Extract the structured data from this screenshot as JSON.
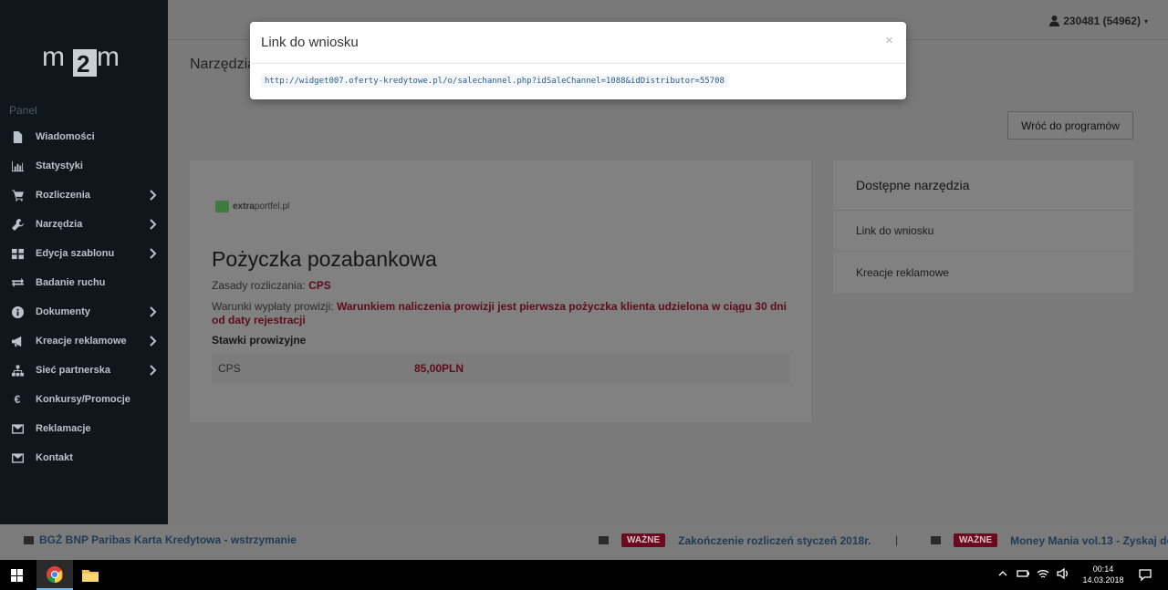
{
  "sidebar": {
    "logo_text": "m2m",
    "panel_label": "Panel",
    "items": [
      {
        "label": "Wiadomości",
        "icon": "document-icon"
      },
      {
        "label": "Statystyki",
        "icon": "bar-chart-icon"
      },
      {
        "label": "Rozliczenia",
        "icon": "cart-icon"
      },
      {
        "label": "Narzędzia",
        "icon": "wrench-icon"
      },
      {
        "label": "Edycja szablonu",
        "icon": "grid-icon"
      },
      {
        "label": "Badanie ruchu",
        "icon": "exchange-icon"
      },
      {
        "label": "Dokumenty",
        "icon": "info-icon"
      },
      {
        "label": "Kreacje reklamowe",
        "icon": "megaphone-icon"
      },
      {
        "label": "Sieć partnerska",
        "icon": "sitemap-icon"
      },
      {
        "label": "Konkursy/Promocje",
        "icon": "euro-icon"
      },
      {
        "label": "Reklamacje",
        "icon": "envelope-icon"
      },
      {
        "label": "Kontakt",
        "icon": "envelope-icon"
      }
    ]
  },
  "header": {
    "user": "230481 (54962)"
  },
  "main": {
    "page_title": "Narzędzia",
    "back_button": "Wróć do programów",
    "brand_bold": "extra",
    "brand_rest": "portfel.pl",
    "product_title": "Pożyczka pozabankowa",
    "settlement_label": "Zasady rozliczania:",
    "settlement_value": "CPS",
    "payout_label": "Warunki wypłaty prowizji:",
    "payout_value": "Warunkiem naliczenia prowizji jest pierwsza pożyczka klienta udzielona w ciągu 30 dni od daty rejestracji",
    "rates_title": "Stawki prowizyjne",
    "rates": [
      {
        "type": "CPS",
        "amount": "85,00PLN"
      }
    ]
  },
  "tools": {
    "title": "Dostępne narzędzia",
    "items": [
      "Link do wniosku",
      "Kreacje reklamowe"
    ]
  },
  "modal": {
    "title": "Link do wniosku",
    "close": "×",
    "link": "http://widget007.oferty-kredytowe.pl/o/salechannel.php?idSaleChannel=1088&idDistributor=55708"
  },
  "ticker": {
    "item1": "BGŻ BNP Paribas Karta Kredytowa - wstrzymanie",
    "badge": "WAŻNE",
    "item2": "Zakończenie rozliczeń styczeń 2018r.",
    "separator": "|",
    "item3": "Money Mania vol.13 - Zyskaj do"
  },
  "taskbar": {
    "time": "00:14",
    "date": "14.03.2018"
  },
  "colors": {
    "sidebar_bg": "#0f171c",
    "accent_red": "#6b0a1f",
    "overlay": "#7a7a7a"
  }
}
